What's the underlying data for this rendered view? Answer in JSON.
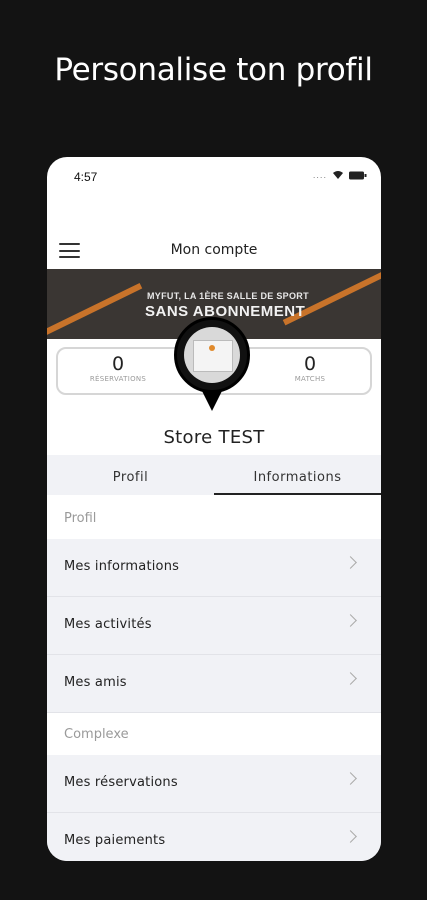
{
  "headline": "Personalise ton profil",
  "status_bar": {
    "time": "4:57",
    "dots": "....",
    "icons": [
      "wifi-icon",
      "battery-icon"
    ]
  },
  "app_bar": {
    "title": "Mon compte",
    "menu_icon": "hamburger-menu-icon"
  },
  "banner": {
    "line1": "MYFUT, LA 1ÈRE SALLE DE SPORT",
    "line2": "SANS ABONNEMENT"
  },
  "stats": {
    "left": {
      "value": "0",
      "label": "RÉSERVATIONS"
    },
    "right": {
      "value": "0",
      "label": "MATCHS"
    }
  },
  "profile": {
    "name": "Store TEST"
  },
  "tabs": [
    {
      "label": "Profil"
    },
    {
      "label": "Informations",
      "active": true
    }
  ],
  "sections": [
    {
      "title": "Profil",
      "items": [
        "Mes informations",
        "Mes activités",
        "Mes amis"
      ]
    },
    {
      "title": "Complexe",
      "items": [
        "Mes réservations",
        "Mes paiements"
      ]
    }
  ],
  "colors": {
    "background": "#131313",
    "accent": "#c8732a",
    "row_bg": "#f1f2f6"
  }
}
